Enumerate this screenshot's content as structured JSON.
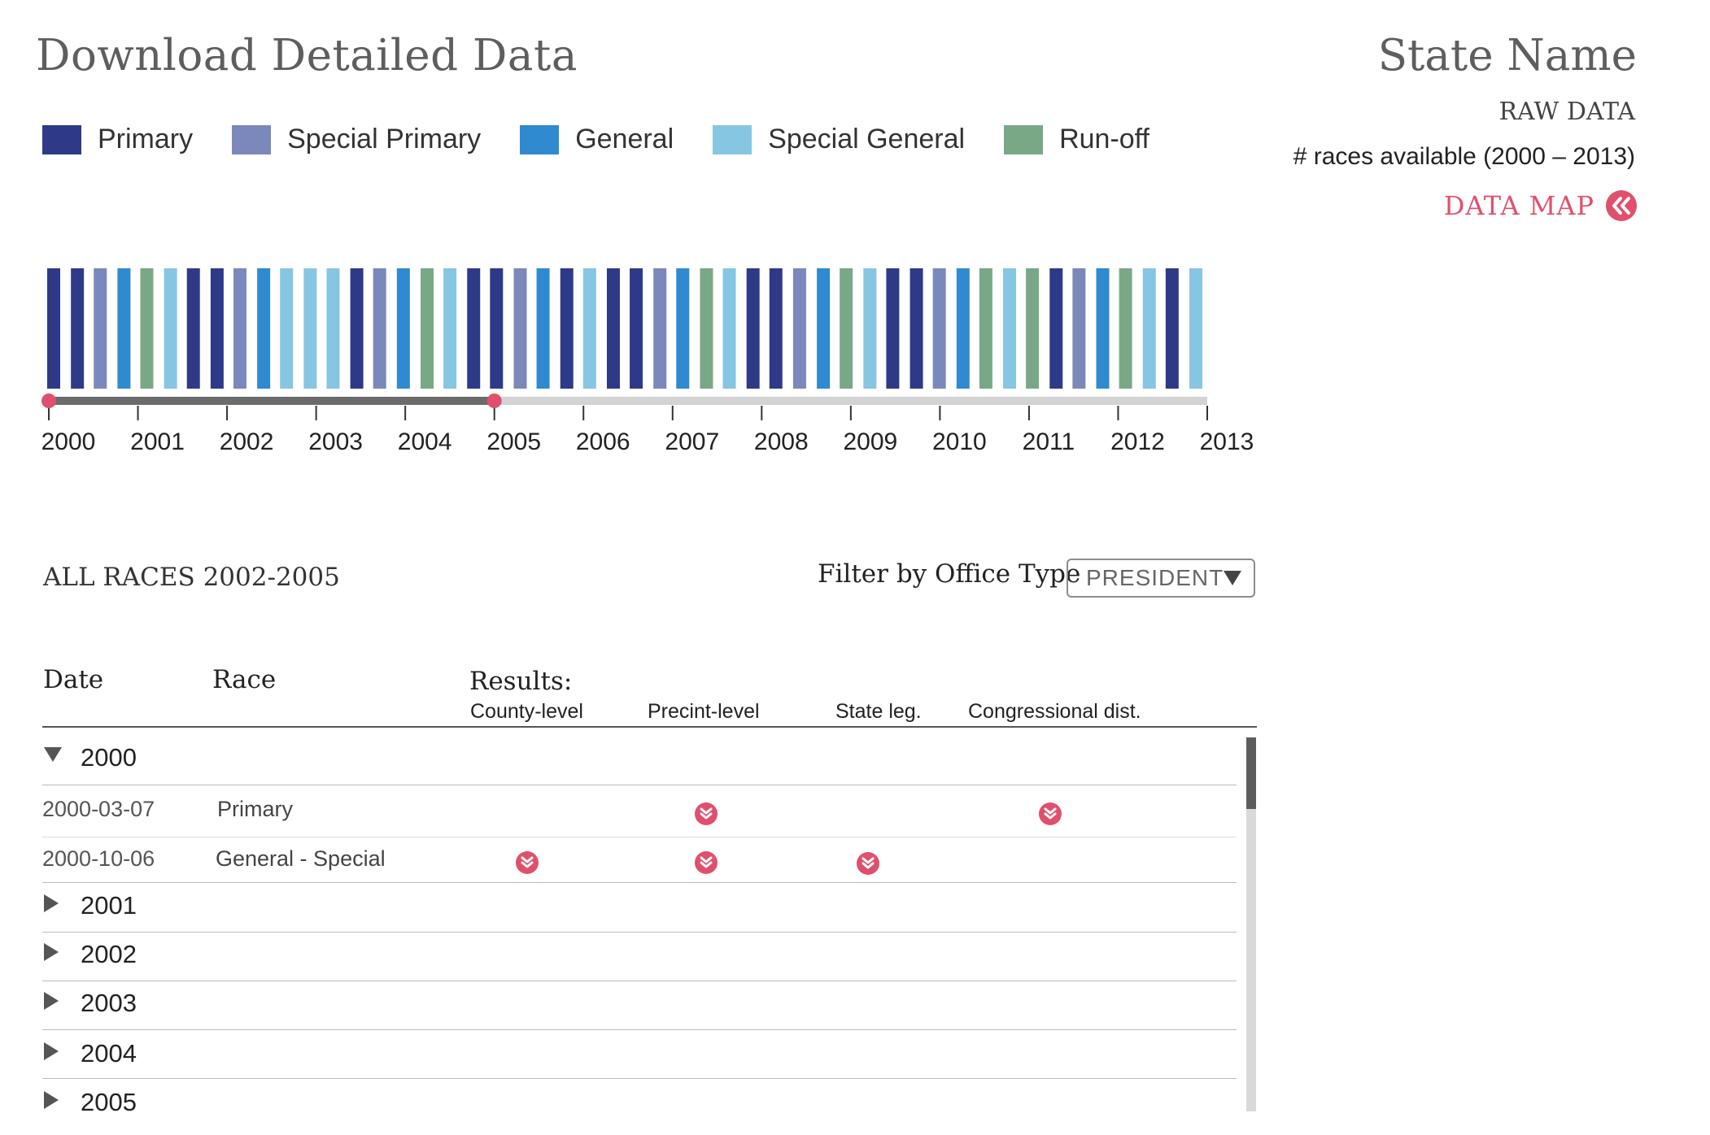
{
  "header": {
    "title": "Download Detailed Data",
    "state_name": "State Name",
    "raw_data": "RAW DATA",
    "races_available": "# races available (2000 – 2013)",
    "data_map_label": "DATA MAP",
    "data_map_icon": "double-chevron-left-icon"
  },
  "legend": [
    {
      "label": "Primary",
      "color": "#2e3a87"
    },
    {
      "label": "Special Primary",
      "color": "#7b88bb"
    },
    {
      "label": "General",
      "color": "#2f8ad0"
    },
    {
      "label": "Special General",
      "color": "#86c6e2"
    },
    {
      "label": "Run-off",
      "color": "#79a887"
    }
  ],
  "chart_data": {
    "type": "bar",
    "description_units": "one bar per race, colored by race type, placed along a 2000–2013 timeline",
    "xlabel": "",
    "ylabel": "",
    "x_range": [
      2000,
      2013
    ],
    "tick_labels": [
      "2000",
      "2001",
      "2002",
      "2003",
      "2004",
      "2005",
      "2006",
      "2007",
      "2008",
      "2009",
      "2010",
      "2011",
      "2012",
      "2013"
    ],
    "races": [
      {
        "x": 2000.0,
        "type": "Primary"
      },
      {
        "x": 2000.27,
        "type": "Primary"
      },
      {
        "x": 2000.53,
        "type": "Special Primary"
      },
      {
        "x": 2000.8,
        "type": "General"
      },
      {
        "x": 2001.06,
        "type": "Run-off"
      },
      {
        "x": 2001.33,
        "type": "Special General"
      },
      {
        "x": 2001.59,
        "type": "Primary"
      },
      {
        "x": 2001.86,
        "type": "Primary"
      },
      {
        "x": 2002.12,
        "type": "Special Primary"
      },
      {
        "x": 2002.39,
        "type": "General"
      },
      {
        "x": 2002.65,
        "type": "Special General"
      },
      {
        "x": 2002.92,
        "type": "Special General"
      },
      {
        "x": 2003.18,
        "type": "Special General"
      },
      {
        "x": 2003.45,
        "type": "Primary"
      },
      {
        "x": 2003.71,
        "type": "Special Primary"
      },
      {
        "x": 2003.98,
        "type": "General"
      },
      {
        "x": 2004.25,
        "type": "Run-off"
      },
      {
        "x": 2004.51,
        "type": "Special General"
      },
      {
        "x": 2004.78,
        "type": "Primary"
      },
      {
        "x": 2005.04,
        "type": "Primary"
      },
      {
        "x": 2005.31,
        "type": "Special Primary"
      },
      {
        "x": 2005.57,
        "type": "General"
      },
      {
        "x": 2005.84,
        "type": "Primary"
      },
      {
        "x": 2006.1,
        "type": "Special General"
      },
      {
        "x": 2006.37,
        "type": "Primary"
      },
      {
        "x": 2006.63,
        "type": "Primary"
      },
      {
        "x": 2006.9,
        "type": "Special Primary"
      },
      {
        "x": 2007.16,
        "type": "General"
      },
      {
        "x": 2007.43,
        "type": "Run-off"
      },
      {
        "x": 2007.69,
        "type": "Special General"
      },
      {
        "x": 2007.96,
        "type": "Primary"
      },
      {
        "x": 2008.22,
        "type": "Primary"
      },
      {
        "x": 2008.49,
        "type": "Special Primary"
      },
      {
        "x": 2008.76,
        "type": "General"
      },
      {
        "x": 2009.02,
        "type": "Run-off"
      },
      {
        "x": 2009.29,
        "type": "Special General"
      },
      {
        "x": 2009.55,
        "type": "Primary"
      },
      {
        "x": 2009.82,
        "type": "Primary"
      },
      {
        "x": 2010.08,
        "type": "Special Primary"
      },
      {
        "x": 2010.35,
        "type": "General"
      },
      {
        "x": 2010.61,
        "type": "Run-off"
      },
      {
        "x": 2010.88,
        "type": "Special General"
      },
      {
        "x": 2011.14,
        "type": "Run-off"
      },
      {
        "x": 2011.41,
        "type": "Primary"
      },
      {
        "x": 2011.67,
        "type": "Special Primary"
      },
      {
        "x": 2011.94,
        "type": "General"
      },
      {
        "x": 2012.2,
        "type": "Run-off"
      },
      {
        "x": 2012.47,
        "type": "Special General"
      },
      {
        "x": 2012.73,
        "type": "Primary"
      },
      {
        "x": 2013.0,
        "type": "Special General"
      }
    ],
    "selected_range": [
      2000,
      2005
    ],
    "grid": false,
    "legend_position": "top-left"
  },
  "filter": {
    "heading": "ALL RACES 2002-2005",
    "label": "Filter by Office Type",
    "selected": "PRESIDENT"
  },
  "table": {
    "col_date": "Date",
    "col_race": "Race",
    "results_label": "Results:",
    "sub_cols": [
      "County-level",
      "Precint-level",
      "State leg.",
      "Congressional dist."
    ],
    "years": [
      {
        "year": "2000",
        "expanded": true,
        "rows": [
          {
            "date": "2000-03-07",
            "race": "Primary",
            "downloads": [
              false,
              true,
              false,
              true
            ]
          },
          {
            "date": "2000-10-06",
            "race": "General - Special",
            "downloads": [
              true,
              true,
              true,
              false
            ]
          }
        ]
      },
      {
        "year": "2001",
        "expanded": false
      },
      {
        "year": "2002",
        "expanded": false
      },
      {
        "year": "2003",
        "expanded": false
      },
      {
        "year": "2004",
        "expanded": false
      },
      {
        "year": "2005",
        "expanded": false
      }
    ],
    "download_icon": "download-chevron-icon",
    "download_icon_color": "#e0506c"
  }
}
